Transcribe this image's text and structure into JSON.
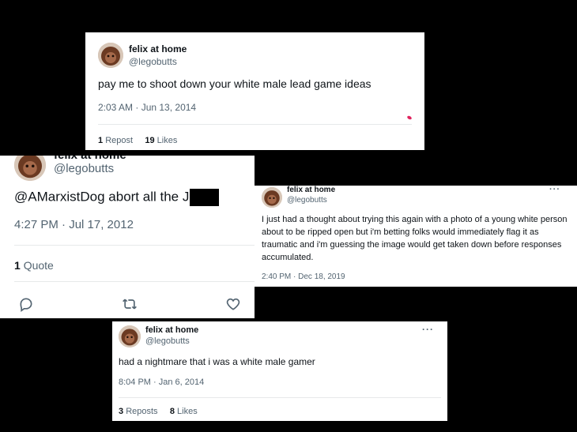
{
  "tweets": [
    {
      "name": "felix at home",
      "handle": "@legobutts",
      "text": "pay me to shoot down your white male lead game ideas",
      "timestamp": "2:03 AM · Jun 13, 2014",
      "stats": [
        {
          "count": "1",
          "label": "Repost"
        },
        {
          "count": "19",
          "label": "Likes"
        }
      ]
    },
    {
      "name": "felix at home",
      "handle": "@legobutts",
      "text": "@AMarxistDog abort all the J",
      "timestamp": "4:27 PM · Jul 17, 2012",
      "stats": [
        {
          "count": "1",
          "label": "Quote"
        }
      ],
      "actions": [
        "reply-icon",
        "repost-icon",
        "like-icon"
      ]
    },
    {
      "name": "felix at home",
      "handle": "@legobutts",
      "more": "···",
      "text": "I just had a thought about trying this again with a photo of a young white person about to be ripped open but i'm betting folks would immediately flag it as traumatic and i'm guessing the image would get taken down before responses accumulated.",
      "timestamp": "2:40 PM · Dec 18, 2019"
    },
    {
      "name": "felix at home",
      "handle": "@legobutts",
      "more": "···",
      "text": "had a nightmare that i was a white male gamer",
      "timestamp": "8:04 PM · Jan 6, 2014",
      "stats": [
        {
          "count": "3",
          "label": "Reposts"
        },
        {
          "count": "8",
          "label": "Likes"
        }
      ]
    }
  ],
  "colors": {
    "text": "#0f1419",
    "muted": "#536471",
    "rule": "#e7e9ea",
    "background": "#000000"
  }
}
